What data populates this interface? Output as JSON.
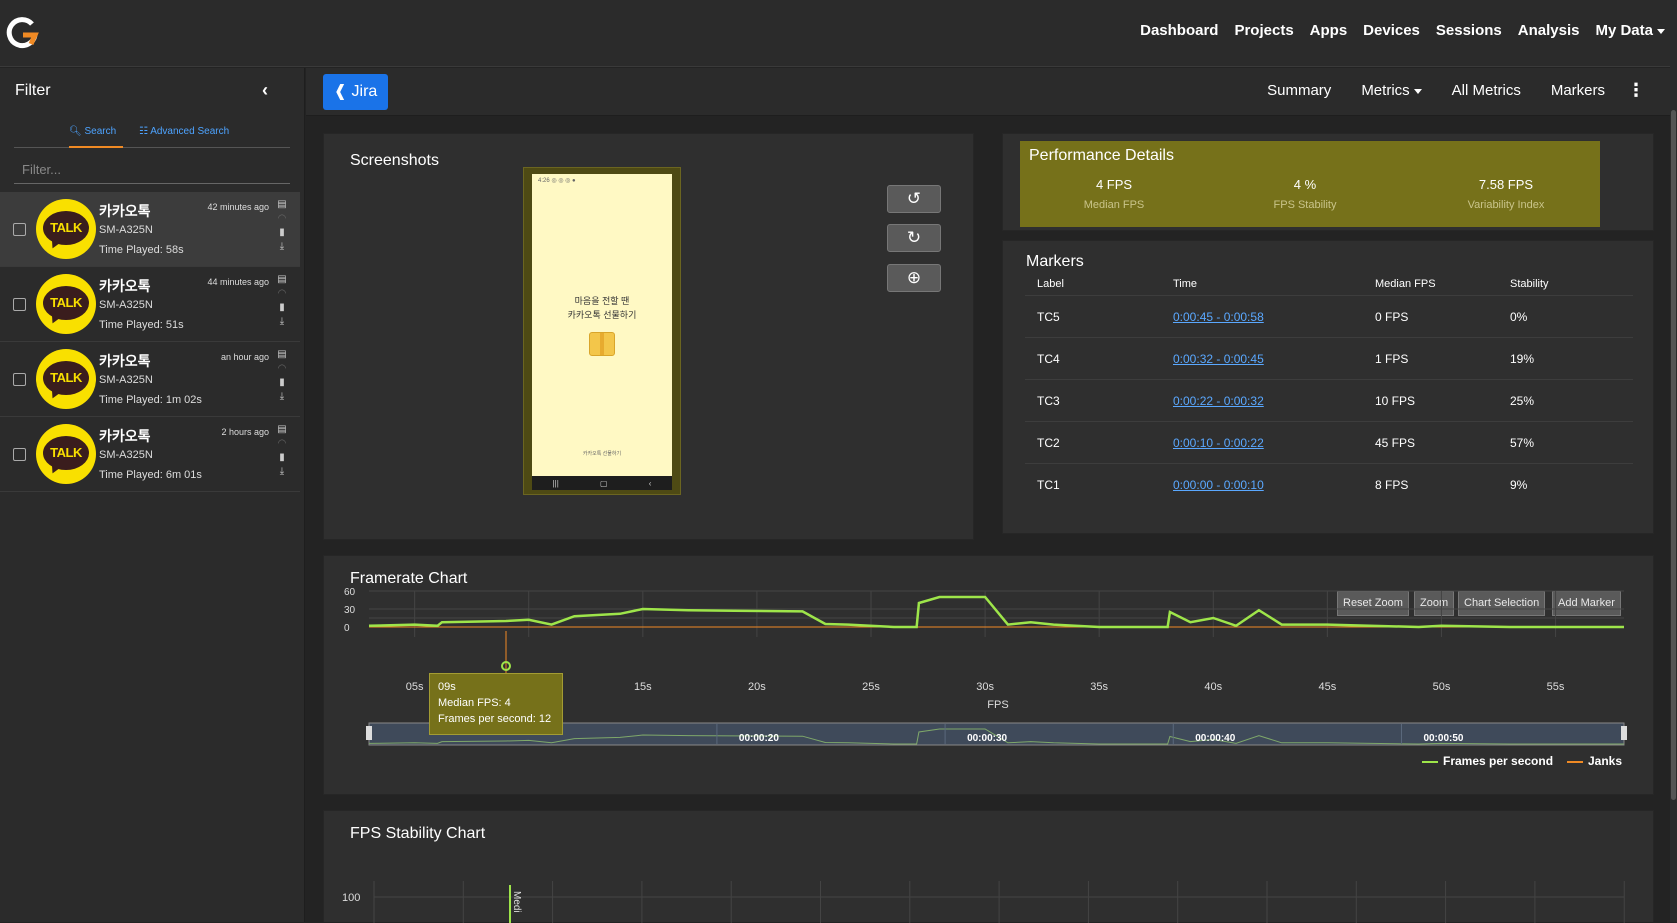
{
  "nav": {
    "items": [
      "Dashboard",
      "Projects",
      "Apps",
      "Devices",
      "Sessions",
      "Analysis",
      "My Data"
    ]
  },
  "sidebar": {
    "title": "Filter",
    "search_tab": "Search",
    "advanced_tab": "Advanced Search",
    "filter_placeholder": "Filter...",
    "sessions": [
      {
        "app": "카카오톡",
        "device": "SM-A325N",
        "played": "Time Played: 58s",
        "time": "42 minutes ago",
        "icon_text": "TALK"
      },
      {
        "app": "카카오톡",
        "device": "SM-A325N",
        "played": "Time Played: 51s",
        "time": "44 minutes ago",
        "icon_text": "TALK"
      },
      {
        "app": "카카오톡",
        "device": "SM-A325N",
        "played": "Time Played: 1m 02s",
        "time": "an hour ago",
        "icon_text": "TALK"
      },
      {
        "app": "카카오톡",
        "device": "SM-A325N",
        "played": "Time Played: 6m 01s",
        "time": "2 hours ago",
        "icon_text": "TALK"
      }
    ]
  },
  "subbar": {
    "jira": "Jira",
    "items": [
      "Summary",
      "Metrics",
      "All Metrics",
      "Markers"
    ]
  },
  "screenshots": {
    "title": "Screenshots",
    "screen_lines": [
      "마음을 전할 땐",
      "카카오톡 선물하기"
    ],
    "screen_footer": "카카오톡 선물하기",
    "screen_status": "4:26 ◎ ◎ ◎ ●"
  },
  "performance": {
    "title": "Performance Details",
    "metrics": [
      {
        "value": "4 FPS",
        "label": "Median FPS"
      },
      {
        "value": "4 %",
        "label": "FPS Stability"
      },
      {
        "value": "7.58 FPS",
        "label": "Variability Index"
      }
    ]
  },
  "markers": {
    "title": "Markers",
    "headers": [
      "Label",
      "Time",
      "Median FPS",
      "Stability"
    ],
    "rows": [
      {
        "label": "TC5",
        "time": "0:00:45 - 0:00:58",
        "fps": "0 FPS",
        "stability": "0%"
      },
      {
        "label": "TC4",
        "time": "0:00:32 - 0:00:45",
        "fps": "1 FPS",
        "stability": "19%"
      },
      {
        "label": "TC3",
        "time": "0:00:22 - 0:00:32",
        "fps": "10 FPS",
        "stability": "25%"
      },
      {
        "label": "TC2",
        "time": "0:00:10 - 0:00:22",
        "fps": "45 FPS",
        "stability": "57%"
      },
      {
        "label": "TC1",
        "time": "0:00:00 - 0:00:10",
        "fps": "8 FPS",
        "stability": "9%"
      }
    ]
  },
  "framerate": {
    "title": "Framerate Chart",
    "buttons": [
      "Reset Zoom",
      "Zoom",
      "Chart Selection",
      "Add Marker"
    ],
    "tooltip": [
      "09s",
      "Median FPS: 4",
      "Frames per second: 12"
    ],
    "navigator_labels": [
      "00:00:20",
      "00:00:30",
      "00:00:40",
      "00:00:50"
    ],
    "legend": [
      {
        "name": "Frames per second",
        "color": "#9ee54a"
      },
      {
        "name": "Janks",
        "color": "#f08a24"
      }
    ]
  },
  "stability": {
    "title": "FPS Stability Chart",
    "y_tick": "100",
    "vertical_label": "Medi"
  },
  "chart_data": {
    "type": "line",
    "xlabel": "FPS",
    "x_ticks": [
      "05s",
      "10s",
      "15s",
      "20s",
      "25s",
      "30s",
      "35s",
      "40s",
      "45s",
      "50s",
      "55s"
    ],
    "y_ticks": [
      "60",
      "30",
      "0"
    ],
    "ylim": [
      0,
      60
    ],
    "xlim": [
      3,
      58
    ],
    "series": [
      {
        "name": "Frames per second",
        "color": "#9ee54a",
        "x": [
          3,
          5,
          6,
          6.2,
          9,
          10,
          11,
          12,
          13,
          14,
          15,
          17,
          19,
          22,
          23,
          24,
          26,
          27,
          27.1,
          28,
          30,
          31,
          32,
          33,
          35,
          38,
          38.1,
          39,
          40,
          41,
          42,
          43,
          45,
          49,
          50,
          53,
          58
        ],
        "y": [
          2,
          4,
          2,
          8,
          10,
          12,
          4,
          18,
          20,
          22,
          30,
          28,
          27,
          26,
          5,
          4,
          0,
          0,
          40,
          50,
          50,
          4,
          8,
          4,
          0,
          0,
          25,
          8,
          15,
          2,
          28,
          4,
          4,
          0,
          2,
          0,
          0
        ]
      },
      {
        "name": "Janks",
        "color": "#f08a24",
        "x": [
          3,
          58
        ],
        "y": [
          0,
          0
        ]
      }
    ]
  }
}
